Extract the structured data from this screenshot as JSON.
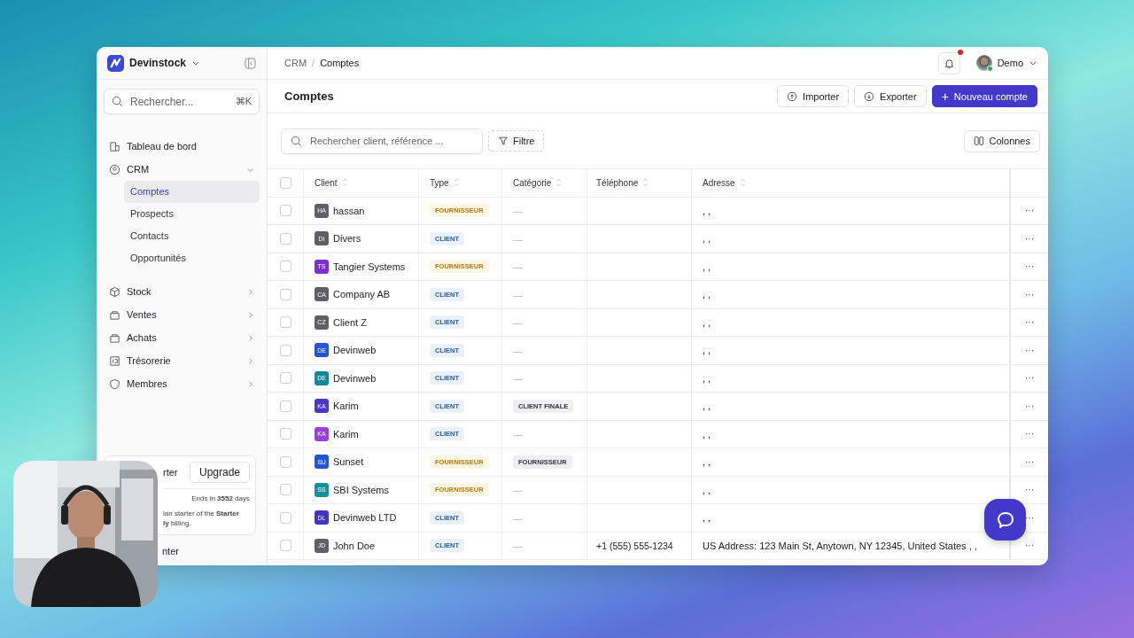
{
  "app": {
    "name": "Devinstock"
  },
  "sidebar": {
    "search": {
      "placeholder": "Rechercher...",
      "shortcut": "⌘K"
    },
    "items": [
      {
        "label": "Tableau de bord",
        "expanded": false
      },
      {
        "label": "CRM",
        "expanded": true,
        "children": [
          {
            "label": "Comptes",
            "selected": true
          },
          {
            "label": "Prospects",
            "selected": false
          },
          {
            "label": "Contacts",
            "selected": false
          },
          {
            "label": "Opportunités",
            "selected": false
          }
        ]
      },
      {
        "label": "Stock",
        "expanded": false
      },
      {
        "label": "Ventes",
        "expanded": false
      },
      {
        "label": "Achats",
        "expanded": false
      },
      {
        "label": "Trésorerie",
        "expanded": false
      },
      {
        "label": "Membres",
        "expanded": false
      }
    ],
    "plan_card": {
      "title": "rter",
      "upgrade": "Upgrade",
      "ends": "Ends in **3552** days",
      "note_1": "lan starter of the **Starter**",
      "note_2": "**ly** billing."
    },
    "footer_link": "nter"
  },
  "breadcrumb": {
    "separator": "/",
    "items": [
      "CRM",
      "Comptes"
    ]
  },
  "notifications": {
    "unread": true
  },
  "user": {
    "name": "Demo",
    "online": true
  },
  "page_title": "Comptes",
  "actions": [
    {
      "label": "Importer",
      "kind": "import"
    },
    {
      "label": "Exporter",
      "kind": "export"
    },
    {
      "label": "Nouveau compte",
      "kind": "primary",
      "glyph": "+"
    }
  ],
  "toolbar": {
    "search": {
      "placeholder": "Rechercher client, référence ..."
    },
    "filter": "Filtre",
    "columns": "Colonnes"
  },
  "table": {
    "all_checked": false,
    "columns": [
      "Client",
      "Type",
      "Catégorie",
      "Téléphone",
      "Adresse"
    ],
    "rows": [
      {
        "checked": false,
        "initials": "HA",
        "color": "#5f5f66",
        "client": "hassan",
        "type": {
          "label": "FOURNISSEUR",
          "kind": "supplier"
        },
        "category": {
          "kind": "empty"
        },
        "address": ", ,",
        "menu": "···"
      },
      {
        "checked": false,
        "initials": "DI",
        "color": "#5f5f66",
        "client": "Divers",
        "type": {
          "label": "CLIENT",
          "kind": "client"
        },
        "category": {
          "kind": "empty"
        },
        "address": ", ,",
        "menu": "···"
      },
      {
        "checked": false,
        "initials": "TS",
        "color": "#7e2fd0",
        "client": "Tangier Systems",
        "type": {
          "label": "FOURNISSEUR",
          "kind": "supplier"
        },
        "category": {
          "kind": "empty"
        },
        "address": ", ,",
        "menu": "···"
      },
      {
        "checked": false,
        "initials": "CA",
        "color": "#5f5f66",
        "client": "Company AB",
        "type": {
          "label": "CLIENT",
          "kind": "client"
        },
        "category": {
          "kind": "empty"
        },
        "address": ", ,",
        "menu": "···"
      },
      {
        "checked": false,
        "initials": "CZ",
        "color": "#5f5f66",
        "client": "Client Z",
        "type": {
          "label": "CLIENT",
          "kind": "client"
        },
        "category": {
          "kind": "empty"
        },
        "address": ", ,",
        "menu": "···"
      },
      {
        "checked": false,
        "initials": "DE",
        "color": "#2455d6",
        "client": "Devinweb",
        "type": {
          "label": "CLIENT",
          "kind": "client"
        },
        "category": {
          "kind": "empty"
        },
        "address": ", ,",
        "menu": "···"
      },
      {
        "checked": false,
        "initials": "DE",
        "color": "#14879a",
        "client": "Devinweb",
        "type": {
          "label": "CLIENT",
          "kind": "client"
        },
        "category": {
          "kind": "empty"
        },
        "address": ", ,",
        "menu": "···"
      },
      {
        "checked": false,
        "initials": "KA",
        "color": "#4a36c8",
        "client": "Karim",
        "type": {
          "label": "CLIENT",
          "kind": "client"
        },
        "category": {
          "kind": "badge",
          "label": "CLIENT FINALE"
        },
        "address": ", ,",
        "menu": "···"
      },
      {
        "checked": false,
        "initials": "KA",
        "color": "#9b3fd8",
        "client": "Karim",
        "type": {
          "label": "CLIENT",
          "kind": "client"
        },
        "category": {
          "kind": "empty"
        },
        "address": ", ,",
        "menu": "···"
      },
      {
        "checked": false,
        "initials": "SU",
        "color": "#2455d6",
        "client": "Sunset",
        "type": {
          "label": "FOURNISSEUR",
          "kind": "supplier"
        },
        "category": {
          "kind": "badge",
          "label": "FOURNISSEUR"
        },
        "address": ", ,",
        "menu": "···"
      },
      {
        "checked": false,
        "initials": "SS",
        "color": "#16909a",
        "client": "SBI Systems",
        "type": {
          "label": "FOURNISSEUR",
          "kind": "supplier"
        },
        "category": {
          "kind": "empty"
        },
        "address": ", ,",
        "menu": "···"
      },
      {
        "checked": false,
        "initials": "DL",
        "color": "#4433c4",
        "client": "Devinweb LTD",
        "type": {
          "label": "CLIENT",
          "kind": "client"
        },
        "category": {
          "kind": "empty"
        },
        "address": ", ,",
        "menu": "···"
      },
      {
        "checked": false,
        "initials": "JD",
        "color": "#5f5f66",
        "client": "John Doe",
        "type": {
          "label": "CLIENT",
          "kind": "client"
        },
        "category": {
          "kind": "empty"
        },
        "phone": "+1 (555) 555-1234",
        "address": "US Address: 123 Main St, Anytown, NY 12345, United States , ,",
        "menu": "···"
      }
    ]
  }
}
